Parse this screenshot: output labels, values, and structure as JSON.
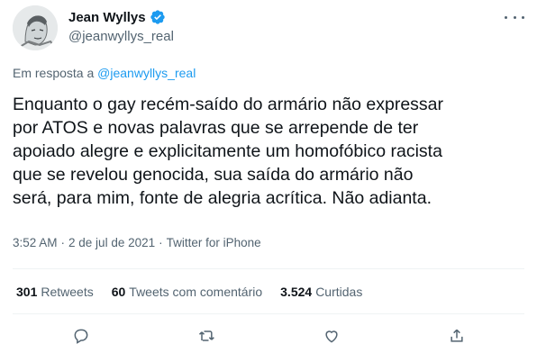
{
  "author": {
    "name": "Jean Wyllys",
    "handle": "@jeanwyllys_real",
    "verified_icon": "verified-badge-icon",
    "avatar_icon": "avatar"
  },
  "reply": {
    "prefix": "Em resposta a",
    "mention": "@jeanwyllys_real"
  },
  "tweet": {
    "text": "Enquanto o gay recém-saído do armário não expressar\npor ATOS e novas palavras que se arrepende de ter\napoiado alegre e explicitamente um homofóbico racista\nque se revelou genocida, sua saída do armário não\nserá, para mim, fonte de alegria acrítica. Não adianta."
  },
  "meta": {
    "time": "3:52 AM",
    "date": "2 de jul de 2021",
    "separator": "·",
    "source": "Twitter for iPhone"
  },
  "stats": {
    "retweets_count": "301",
    "retweets_label": "Retweets",
    "quotes_count": "60",
    "quotes_label": "Tweets com comentário",
    "likes_count": "3.524",
    "likes_label": "Curtidas"
  },
  "colors": {
    "accent": "#1d9bf0",
    "text": "#0f1419",
    "secondary": "#536471",
    "divider": "#eff3f4"
  },
  "actions": [
    "reply-icon",
    "retweet-icon",
    "like-icon",
    "share-icon"
  ]
}
